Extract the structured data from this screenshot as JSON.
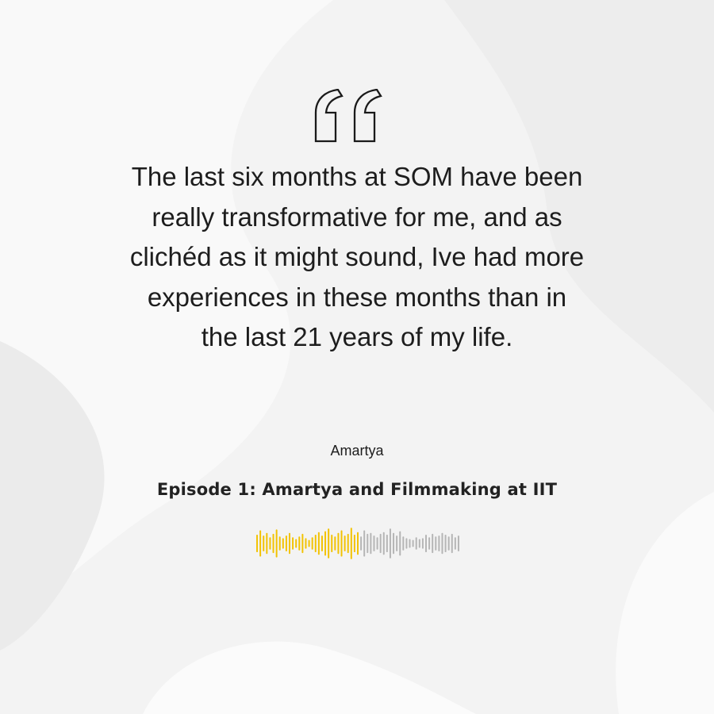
{
  "quote": {
    "lines": [
      "The last six months at SOM have been",
      "really transformative for me, and as",
      "clichéd as it might sound, Ive had more",
      "experiences in these months than in",
      "the last 21 years of my life."
    ]
  },
  "author": "Amartya",
  "episode": {
    "title": "Episode 1: Amartya and Filmmaking at IIT"
  },
  "player": {
    "progress": 0.5,
    "played_color": "#f2c200",
    "remaining_color": "#b5b5b5",
    "levels": [
      0.5,
      0.75,
      0.45,
      0.6,
      0.35,
      0.55,
      0.8,
      0.4,
      0.3,
      0.45,
      0.6,
      0.35,
      0.25,
      0.4,
      0.55,
      0.3,
      0.2,
      0.35,
      0.5,
      0.65,
      0.45,
      0.7,
      0.85,
      0.5,
      0.4,
      0.6,
      0.75,
      0.45,
      0.55,
      0.9,
      0.5,
      0.65,
      0.4,
      0.75,
      0.55,
      0.6,
      0.45,
      0.35,
      0.55,
      0.65,
      0.5,
      0.85,
      0.6,
      0.45,
      0.7,
      0.4,
      0.3,
      0.25,
      0.2,
      0.35,
      0.25,
      0.3,
      0.5,
      0.35,
      0.55,
      0.4,
      0.45,
      0.6,
      0.5,
      0.4,
      0.55,
      0.35,
      0.45
    ]
  }
}
